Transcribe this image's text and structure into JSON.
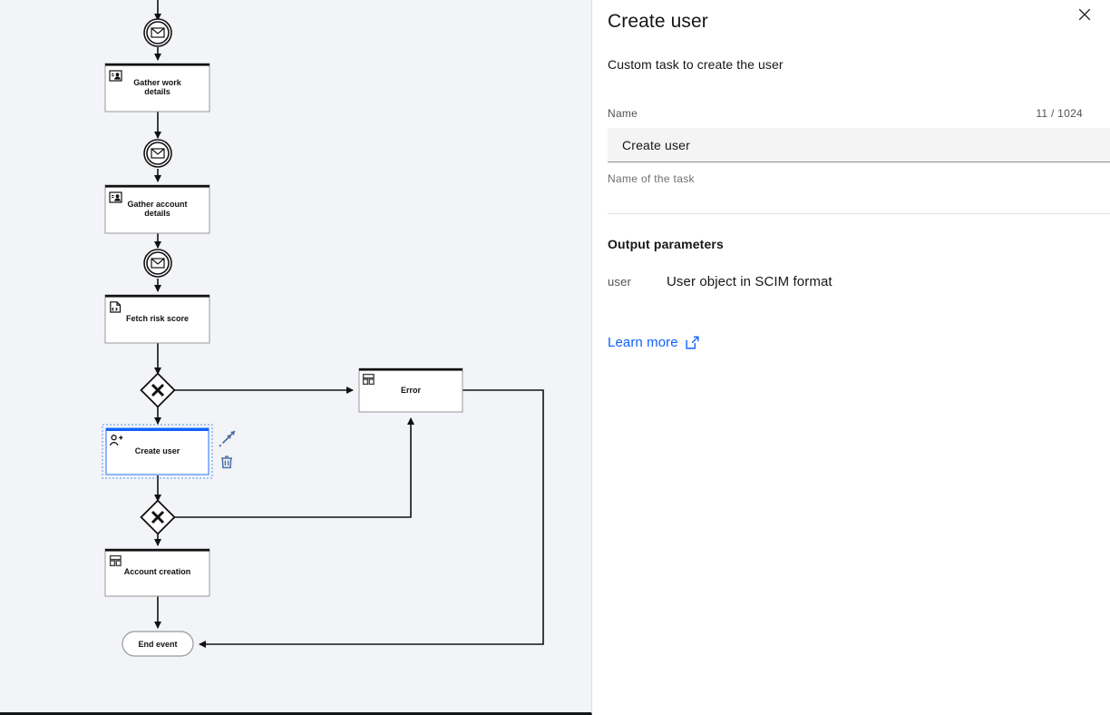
{
  "panel": {
    "title": "Create user",
    "close_icon": "close-icon",
    "description": "Custom task to create the user",
    "name_field": {
      "label": "Name",
      "counter": "11 / 1024",
      "value": "Create user",
      "placeholder": "Name of the task",
      "help": "Name of the task"
    },
    "output_section": {
      "title": "Output parameters",
      "parameters": [
        {
          "key": "user",
          "description": "User object in SCIM format"
        }
      ]
    },
    "learn_more": {
      "label": "Learn more",
      "icon": "external-link-icon"
    },
    "accent_color": "#0f62fe"
  },
  "canvas": {
    "background_color": "#f2f4f8",
    "selection_color": "#0f62fe",
    "nodes": [
      {
        "id": "msg-1",
        "type": "intermediate-message-event",
        "label": "",
        "icon": "envelope-icon"
      },
      {
        "id": "task-1",
        "type": "user-task",
        "label": "Gather work\ndetails",
        "icon": "user-task-icon"
      },
      {
        "id": "msg-2",
        "type": "intermediate-message-event",
        "label": "",
        "icon": "envelope-icon"
      },
      {
        "id": "task-2",
        "type": "user-task",
        "label": "Gather account\ndetails",
        "icon": "user-task-icon"
      },
      {
        "id": "msg-3",
        "type": "intermediate-message-event",
        "label": "",
        "icon": "envelope-icon"
      },
      {
        "id": "task-3",
        "type": "script-task",
        "label": "Fetch risk score",
        "icon": "script-icon"
      },
      {
        "id": "gw-1",
        "type": "exclusive-gateway",
        "label": "",
        "icon": "x-gateway-icon"
      },
      {
        "id": "task-4",
        "type": "service-task",
        "label": "Create user",
        "icon": "add-user-icon",
        "selected": true
      },
      {
        "id": "gw-2",
        "type": "exclusive-gateway",
        "label": "",
        "icon": "x-gateway-icon"
      },
      {
        "id": "task-5",
        "type": "call-activity",
        "label": "Account creation",
        "icon": "subprocess-icon"
      },
      {
        "id": "task-6",
        "type": "call-activity",
        "label": "Error",
        "icon": "subprocess-icon"
      },
      {
        "id": "end-1",
        "type": "end-event",
        "label": "End event",
        "icon": ""
      }
    ],
    "labels": {
      "gather_work": "Gather work",
      "gather_work_2": "details",
      "gather_account": "Gather account",
      "gather_account_2": "details",
      "fetch_risk": "Fetch risk score",
      "create_user": "Create user",
      "account_creation": "Account creation",
      "error": "Error",
      "end_event": "End event"
    },
    "context_pad": [
      {
        "name": "append-icon",
        "title": "Append"
      },
      {
        "name": "delete-icon",
        "title": "Delete"
      }
    ]
  }
}
